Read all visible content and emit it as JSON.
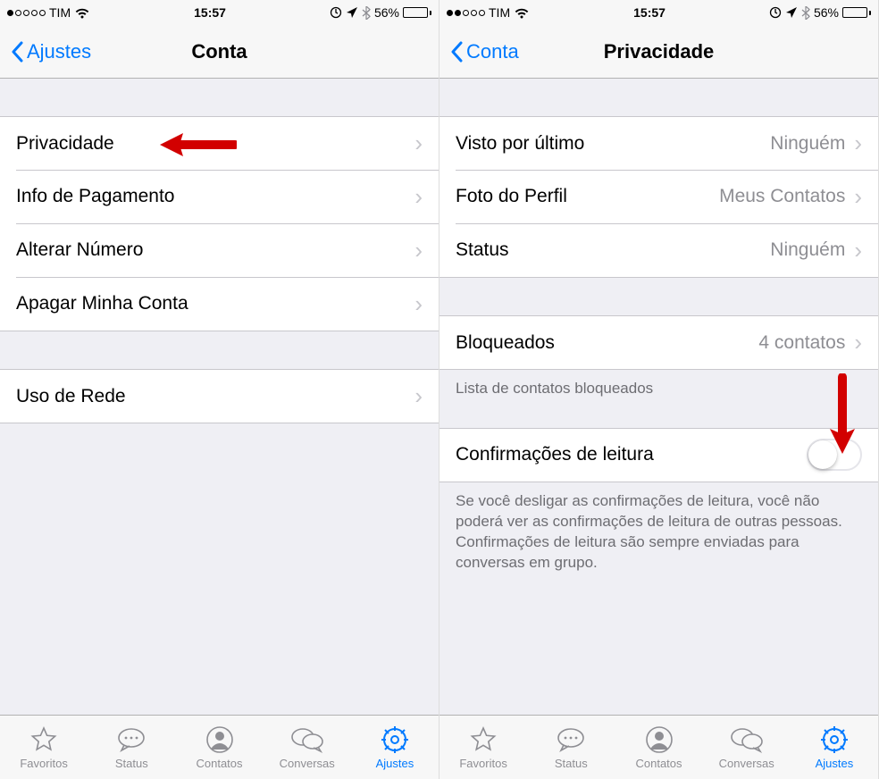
{
  "statusbar": {
    "carrier": "TIM",
    "time": "15:57",
    "battery_pct": "56%",
    "signal_filled_left": 1,
    "signal_filled_right": 2
  },
  "left": {
    "nav": {
      "back": "Ajustes",
      "title": "Conta"
    },
    "rows": {
      "privacy": "Privacidade",
      "payment": "Info de Pagamento",
      "change_number": "Alterar Número",
      "delete_account": "Apagar Minha Conta",
      "network": "Uso de Rede"
    }
  },
  "right": {
    "nav": {
      "back": "Conta",
      "title": "Privacidade"
    },
    "rows": {
      "last_seen": {
        "label": "Visto por último",
        "value": "Ninguém"
      },
      "profile_photo": {
        "label": "Foto do Perfil",
        "value": "Meus Contatos"
      },
      "status": {
        "label": "Status",
        "value": "Ninguém"
      },
      "blocked": {
        "label": "Bloqueados",
        "value": "4 contatos"
      },
      "blocked_footer": "Lista de contatos bloqueados",
      "read_receipts": {
        "label": "Confirmações de leitura"
      },
      "read_receipts_footer": "Se você desligar as confirmações de leitura, você não poderá ver as confirmações de leitura de outras pessoas. Confirmações de leitura são sempre enviadas para conversas em grupo."
    }
  },
  "tabs": {
    "favorites": "Favoritos",
    "status": "Status",
    "contacts": "Contatos",
    "chats": "Conversas",
    "settings": "Ajustes"
  }
}
